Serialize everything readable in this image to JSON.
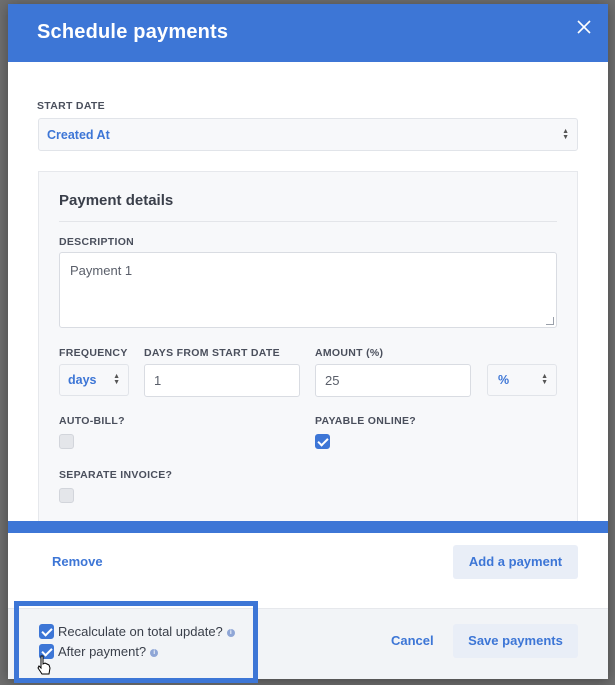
{
  "modal": {
    "title": "Schedule payments",
    "close_icon": "close-icon"
  },
  "start_date": {
    "label": "START DATE",
    "value": "Created At"
  },
  "payment_details": {
    "title": "Payment details",
    "description": {
      "label": "DESCRIPTION",
      "value": "Payment 1"
    },
    "frequency": {
      "label": "FREQUENCY",
      "value": "days"
    },
    "days_from_start": {
      "label": "DAYS FROM START DATE",
      "value": "1"
    },
    "amount": {
      "label": "AMOUNT (%)",
      "value": "25",
      "unit": "%"
    },
    "auto_bill": {
      "label": "AUTO-BILL?",
      "checked": false
    },
    "payable_online": {
      "label": "PAYABLE ONLINE?",
      "checked": true
    },
    "separate_invoice": {
      "label": "SEPARATE INVOICE?",
      "checked": false
    }
  },
  "actions": {
    "remove_label": "Remove",
    "add_payment_label": "Add a payment"
  },
  "footer": {
    "recalculate_label": "Recalculate on total update?",
    "recalculate_checked": true,
    "after_payment_label": "After payment?",
    "after_payment_checked": true,
    "cancel_label": "Cancel",
    "save_label": "Save payments"
  },
  "colors": {
    "accent": "#3d76d6",
    "header_bg": "#3d76d6",
    "panel_bg": "#f7f8fa"
  }
}
